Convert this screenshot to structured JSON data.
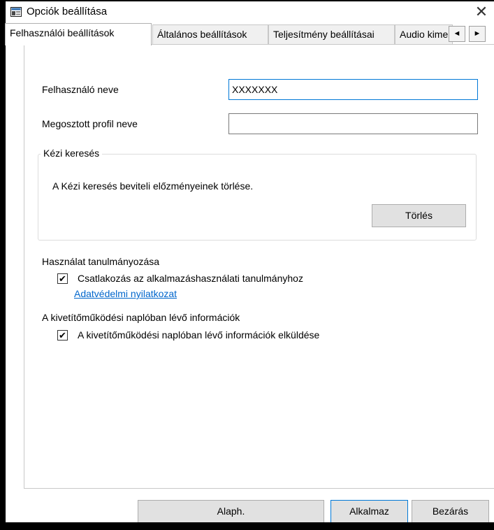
{
  "window": {
    "title": "Opciók beállítása",
    "close_glyph": "✕"
  },
  "tabs": [
    {
      "label": "Felhasználói beállítások",
      "active": true
    },
    {
      "label": "Általános beállítások"
    },
    {
      "label": "Teljesítmény beállításai"
    },
    {
      "label": "Audio kimenet"
    }
  ],
  "tab_scroll": {
    "left": "◄",
    "right": "►"
  },
  "form": {
    "username_label": "Felhasználó neve",
    "username_value": "XXXXXXX",
    "shared_profile_label": "Megosztott profil neve",
    "shared_profile_value": ""
  },
  "manual_search": {
    "group_title": "Kézi keresés",
    "description": "A Kézi keresés beviteli előzményeinek törlése.",
    "clear_button": "Törlés"
  },
  "usage_study": {
    "heading": "Használat tanulmányozása",
    "checkbox_label": "Csatlakozás az alkalmazáshasználati tanulmányhoz",
    "checked": true,
    "privacy_link": "Adatvédelmi nyilatkozat"
  },
  "output_log": {
    "heading": "A kivetítőműködési naplóban lévő információk",
    "checkbox_label": "A kivetítőműködési naplóban lévő információk elküldése",
    "checked": true
  },
  "footer": {
    "defaults_button": "Alaph.",
    "apply_button": "Alkalmaz",
    "close_button": "Bezárás"
  },
  "colors": {
    "accent": "#0078d7",
    "link": "#0066cc"
  },
  "icons": {
    "app": "options-window-icon",
    "check": "✔"
  }
}
